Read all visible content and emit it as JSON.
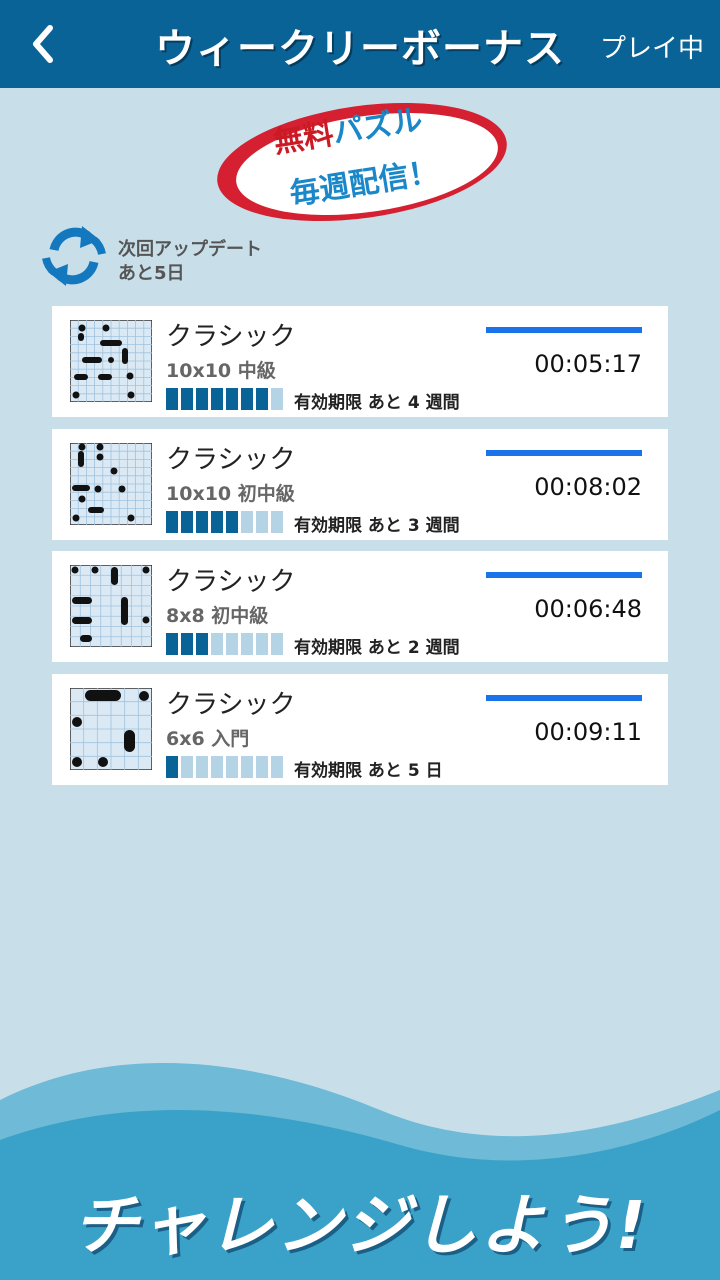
{
  "header": {
    "title": "ウィークリーボーナス",
    "status": "プレイ中",
    "back_icon": "chevron-left-icon"
  },
  "badge": {
    "line1_red": "無料",
    "line1_blue": "パズル",
    "line2": "毎週配信！"
  },
  "update": {
    "icon": "refresh-icon",
    "line1": "次回アップデート",
    "line2": "あと5日"
  },
  "puzzles": [
    {
      "title": "クラシック",
      "subtitle": "10x10 中級",
      "expiry": "有効期限 あと 4 週間",
      "time": "00:05:17",
      "progress_filled": 7,
      "progress_total": 8,
      "grid": 10
    },
    {
      "title": "クラシック",
      "subtitle": "10x10 初中級",
      "expiry": "有効期限 あと 3 週間",
      "time": "00:08:02",
      "progress_filled": 5,
      "progress_total": 8,
      "grid": 10
    },
    {
      "title": "クラシック",
      "subtitle": "8x8 初中級",
      "expiry": "有効期限 あと 2 週間",
      "time": "00:06:48",
      "progress_filled": 3,
      "progress_total": 8,
      "grid": 8
    },
    {
      "title": "クラシック",
      "subtitle": "6x6 入門",
      "expiry": "有効期限 あと 5 日",
      "time": "00:09:11",
      "progress_filled": 1,
      "progress_total": 8,
      "grid": 6
    }
  ],
  "footer": {
    "text": "チャレンジしよう!"
  },
  "colors": {
    "header": "#0a6396",
    "background": "#c8dfea",
    "progress_filled": "#0a6396",
    "progress_empty": "#b4d3e4",
    "time_bar": "#1a73e8",
    "badge_red": "#cc1a25"
  }
}
